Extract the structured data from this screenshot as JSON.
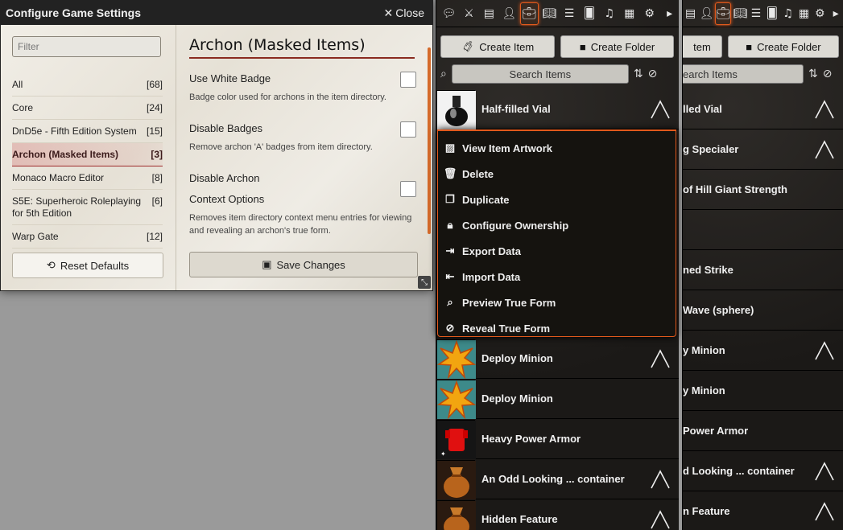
{
  "settings_window": {
    "title": "Configure Game Settings",
    "close_label": "Close",
    "filter_placeholder": "Filter",
    "categories": [
      {
        "label": "All",
        "count": "[68]"
      },
      {
        "label": "Core",
        "count": "[24]"
      },
      {
        "label": "DnD5e - Fifth Edition System",
        "count": "[15]"
      },
      {
        "label": "Archon (Masked Items)",
        "count": "[3]",
        "active": true
      },
      {
        "label": "Monaco Macro Editor",
        "count": "[8]"
      },
      {
        "label": "S5E: Superheroic Roleplaying for 5th Edition",
        "count": "[6]"
      },
      {
        "label": "Warp Gate",
        "count": "[12]"
      }
    ],
    "reset_label": "Reset Defaults",
    "section_title": "Archon (Masked Items)",
    "settings": [
      {
        "name": "Use White Badge",
        "hint": "Badge color used for archons in the item directory.",
        "checked": false
      },
      {
        "name": "Disable Badges",
        "hint": "Remove archon 'A' badges from item directory.",
        "checked": false
      },
      {
        "name": "Disable Archon Context Options",
        "hint": "Removes item directory context menu entries for viewing and revealing an archon's true form.",
        "checked": false
      }
    ],
    "save_label": "Save Changes"
  },
  "sidebar": {
    "tabs": [
      "chat-icon",
      "combat-icon",
      "scenes-icon",
      "actors-icon",
      "items-icon",
      "journal-icon",
      "tables-icon",
      "cards-icon",
      "playlists-icon",
      "compendium-icon",
      "settings-icon",
      "collapse-icon"
    ],
    "active_tab": "items-icon",
    "create_item_label": "Create Item",
    "create_folder_label": "Create Folder",
    "search_placeholder": "Search Items",
    "items": [
      {
        "name": "Half-filled Vial",
        "thumb": "vial",
        "badge": true
      },
      {
        "name": "Deploy Minion",
        "thumb": "burst",
        "badge": true
      },
      {
        "name": "Deploy Minion",
        "thumb": "burst",
        "badge": false
      },
      {
        "name": "Heavy Power Armor",
        "thumb": "armor",
        "badge": false
      },
      {
        "name": "An Odd Looking ... container",
        "thumb": "sack",
        "badge": true
      },
      {
        "name": "Hidden Feature",
        "thumb": "sack",
        "badge": true
      }
    ]
  },
  "sidebar2": {
    "items": [
      {
        "name": "lled Vial",
        "badge": true
      },
      {
        "name": "g Specialer",
        "badge": true
      },
      {
        "name": "of Hill Giant Strength",
        "badge": false
      },
      {
        "name": "",
        "badge": false
      },
      {
        "name": "ned Strike",
        "badge": false
      },
      {
        "name": "Wave (sphere)",
        "badge": false
      },
      {
        "name": "y Minion",
        "badge": true
      },
      {
        "name": "y Minion",
        "badge": false
      },
      {
        "name": "Power Armor",
        "badge": false
      },
      {
        "name": "d Looking ... container",
        "badge": true
      },
      {
        "name": "n Feature",
        "badge": true
      }
    ],
    "create_item_label": "tem",
    "create_folder_label": "Create Folder",
    "search_placeholder": "earch Items"
  },
  "context_menu": {
    "items": [
      {
        "label": "View Item Artwork",
        "icon": "image-icon"
      },
      {
        "label": "Delete",
        "icon": "trash-icon"
      },
      {
        "label": "Duplicate",
        "icon": "copy-icon"
      },
      {
        "label": "Configure Ownership",
        "icon": "lock-icon"
      },
      {
        "label": "Export Data",
        "icon": "export-icon"
      },
      {
        "label": "Import Data",
        "icon": "import-icon"
      },
      {
        "label": "Preview True Form",
        "icon": "magnify-icon"
      },
      {
        "label": "Reveal True Form",
        "icon": "eye-slash-icon"
      }
    ]
  },
  "colors": {
    "accent": "#e2591c",
    "active_category": "#9e2b2b"
  }
}
